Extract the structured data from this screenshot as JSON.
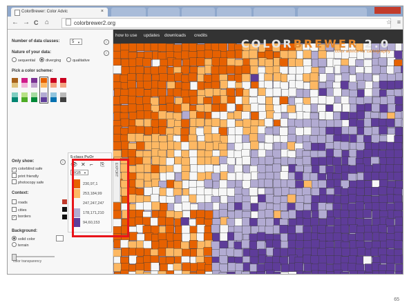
{
  "browser": {
    "tab_title": "ColorBrewer: Color Advic",
    "tab_close": "×",
    "ghost_tabs": [
      "",
      "",
      "",
      "",
      "",
      ""
    ],
    "url": "colorbrewer2.org",
    "back": "←",
    "forward": "→",
    "reload": "C",
    "home": "⌂",
    "star": "☆",
    "menu": "≡"
  },
  "sidebar": {
    "num_classes_label": "Number of data classes:",
    "num_classes_value": "5",
    "nature_label": "Nature of your data:",
    "nature_options": [
      "sequential",
      "diverging",
      "qualitative"
    ],
    "nature_selected": "diverging",
    "pick_label": "Pick a color scheme:",
    "schemes": [
      [
        "#a6611a",
        "#dfc27d",
        "#f5f5f5",
        "#80cdc1",
        "#018571"
      ],
      [
        "#d01c8b",
        "#f1b6da",
        "#f7f7f7",
        "#b8e186",
        "#4dac26"
      ],
      [
        "#7b3294",
        "#c2a5cf",
        "#f7f7f7",
        "#a6dba0",
        "#008837"
      ],
      [
        "#e66101",
        "#fdb863",
        "#f7f7f7",
        "#b2abd2",
        "#5e3c99"
      ],
      [
        "#ca0020",
        "#f4a582",
        "#f7f7f7",
        "#92c5de",
        "#0571b0"
      ],
      [
        "#ca0020",
        "#f4a582",
        "#ffffff",
        "#bababa",
        "#404040"
      ]
    ],
    "selected_scheme_index": 3,
    "only_show_label": "Only show:",
    "only_show": [
      "colorblind safe",
      "print friendly",
      "photocopy safe"
    ],
    "context_label": "Context:",
    "context": [
      "roads",
      "cities",
      "borders"
    ],
    "context_colors": [
      "#c0392b",
      "#111111",
      "#111111"
    ],
    "background_label": "Background:",
    "background_options": [
      "solid color",
      "terrain"
    ],
    "transparency_label": "color transparency",
    "info": "i"
  },
  "map": {
    "nav": [
      "how to use",
      "updates",
      "downloads",
      "credits"
    ],
    "logo_color": "COLOR",
    "logo_brewer": "BREWER",
    "logo_version": "2.0",
    "tagline": "color advice for cartography"
  },
  "legend": {
    "title": "5-class PuOr",
    "icons": [
      "👁",
      "✕",
      "⌐",
      "⎘"
    ],
    "format": "RGB",
    "classes": [
      {
        "value": "230,97,1",
        "color": "#e66101"
      },
      {
        "value": "253,184,99",
        "color": "#fdb863"
      },
      {
        "value": "247,247,247",
        "color": "#f7f7f7"
      },
      {
        "value": "178,171,210",
        "color": "#b2abd2"
      },
      {
        "value": "94,60,153",
        "color": "#5e3c99"
      }
    ],
    "export": "EXPORT"
  },
  "slide": {
    "page_number": "65"
  }
}
